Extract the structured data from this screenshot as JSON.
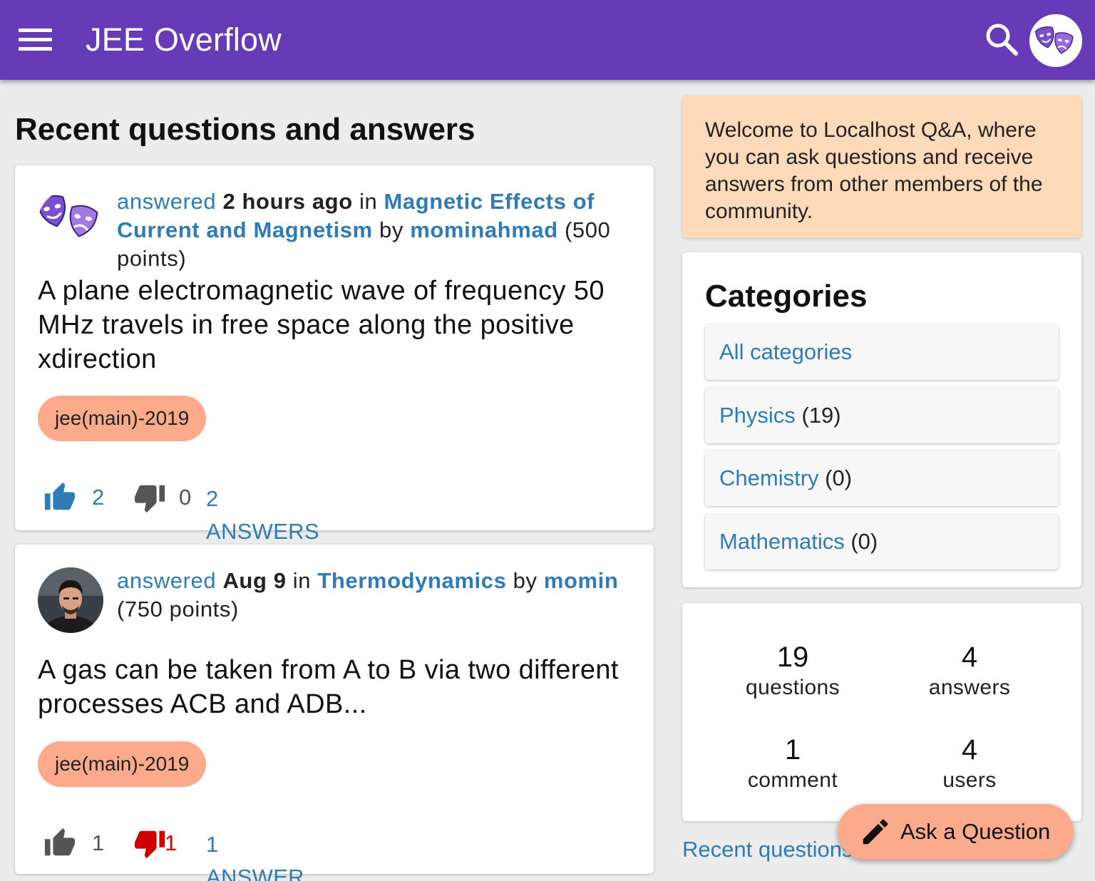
{
  "app": {
    "title": "JEE Overflow",
    "menu_icon": "hamburger-menu-icon",
    "search_icon": "search-icon",
    "brand_color": "#673ab7"
  },
  "main": {
    "heading": "Recent questions and answers",
    "questions": [
      {
        "avatar": "theater-masks-avatar",
        "action": "answered",
        "when": "2 hours ago",
        "in_word": "in",
        "category": "Magnetic Effects of Current and Magnetism",
        "by_word": "by",
        "user": "mominahmad",
        "points": "(500 points)",
        "title": "A plane electromagnetic wave of frequency 50 MHz travels in free space along the positive xdirection",
        "tag": "jee(main)-2019",
        "upvotes": "2",
        "downvotes": "0",
        "answers_label": "2 ANSWERS",
        "upvoted": true,
        "downvoted": false
      },
      {
        "avatar": "user-photo-avatar",
        "action": "answered",
        "when": "Aug 9",
        "in_word": "in",
        "category": "Thermodynamics",
        "by_word": "by",
        "user": "momin",
        "points": "(750 points)",
        "title": "A gas can be taken from A to B via two different processes ACB and ADB...",
        "tag": "jee(main)-2019",
        "upvotes": "1",
        "downvotes": "1",
        "answers_label": "1 ANSWER",
        "upvoted": false,
        "downvoted": true
      }
    ]
  },
  "sidebar": {
    "welcome": "Welcome to Localhost Q&A, where you can ask questions and receive answers from other members of the community.",
    "categories": {
      "heading": "Categories",
      "items": [
        {
          "name": "All categories",
          "count": ""
        },
        {
          "name": "Physics",
          "count": "(19)"
        },
        {
          "name": "Chemistry",
          "count": "(0)"
        },
        {
          "name": "Mathematics",
          "count": "(0)"
        }
      ]
    },
    "stats": [
      {
        "value": "19",
        "label": "questions"
      },
      {
        "value": "4",
        "label": "answers"
      },
      {
        "value": "1",
        "label": "comment"
      },
      {
        "value": "4",
        "label": "users"
      }
    ],
    "recent_link": "Recent questions"
  },
  "fab": {
    "label": "Ask a Question",
    "icon": "pencil-icon"
  },
  "colors": {
    "link": "#2e7bb8",
    "tag_bg": "#fbab8b",
    "welcome_bg": "#ffdab9",
    "upvote_active": "#2e7bb8",
    "downvote_active": "#d00000",
    "vote_inactive": "#555555"
  }
}
